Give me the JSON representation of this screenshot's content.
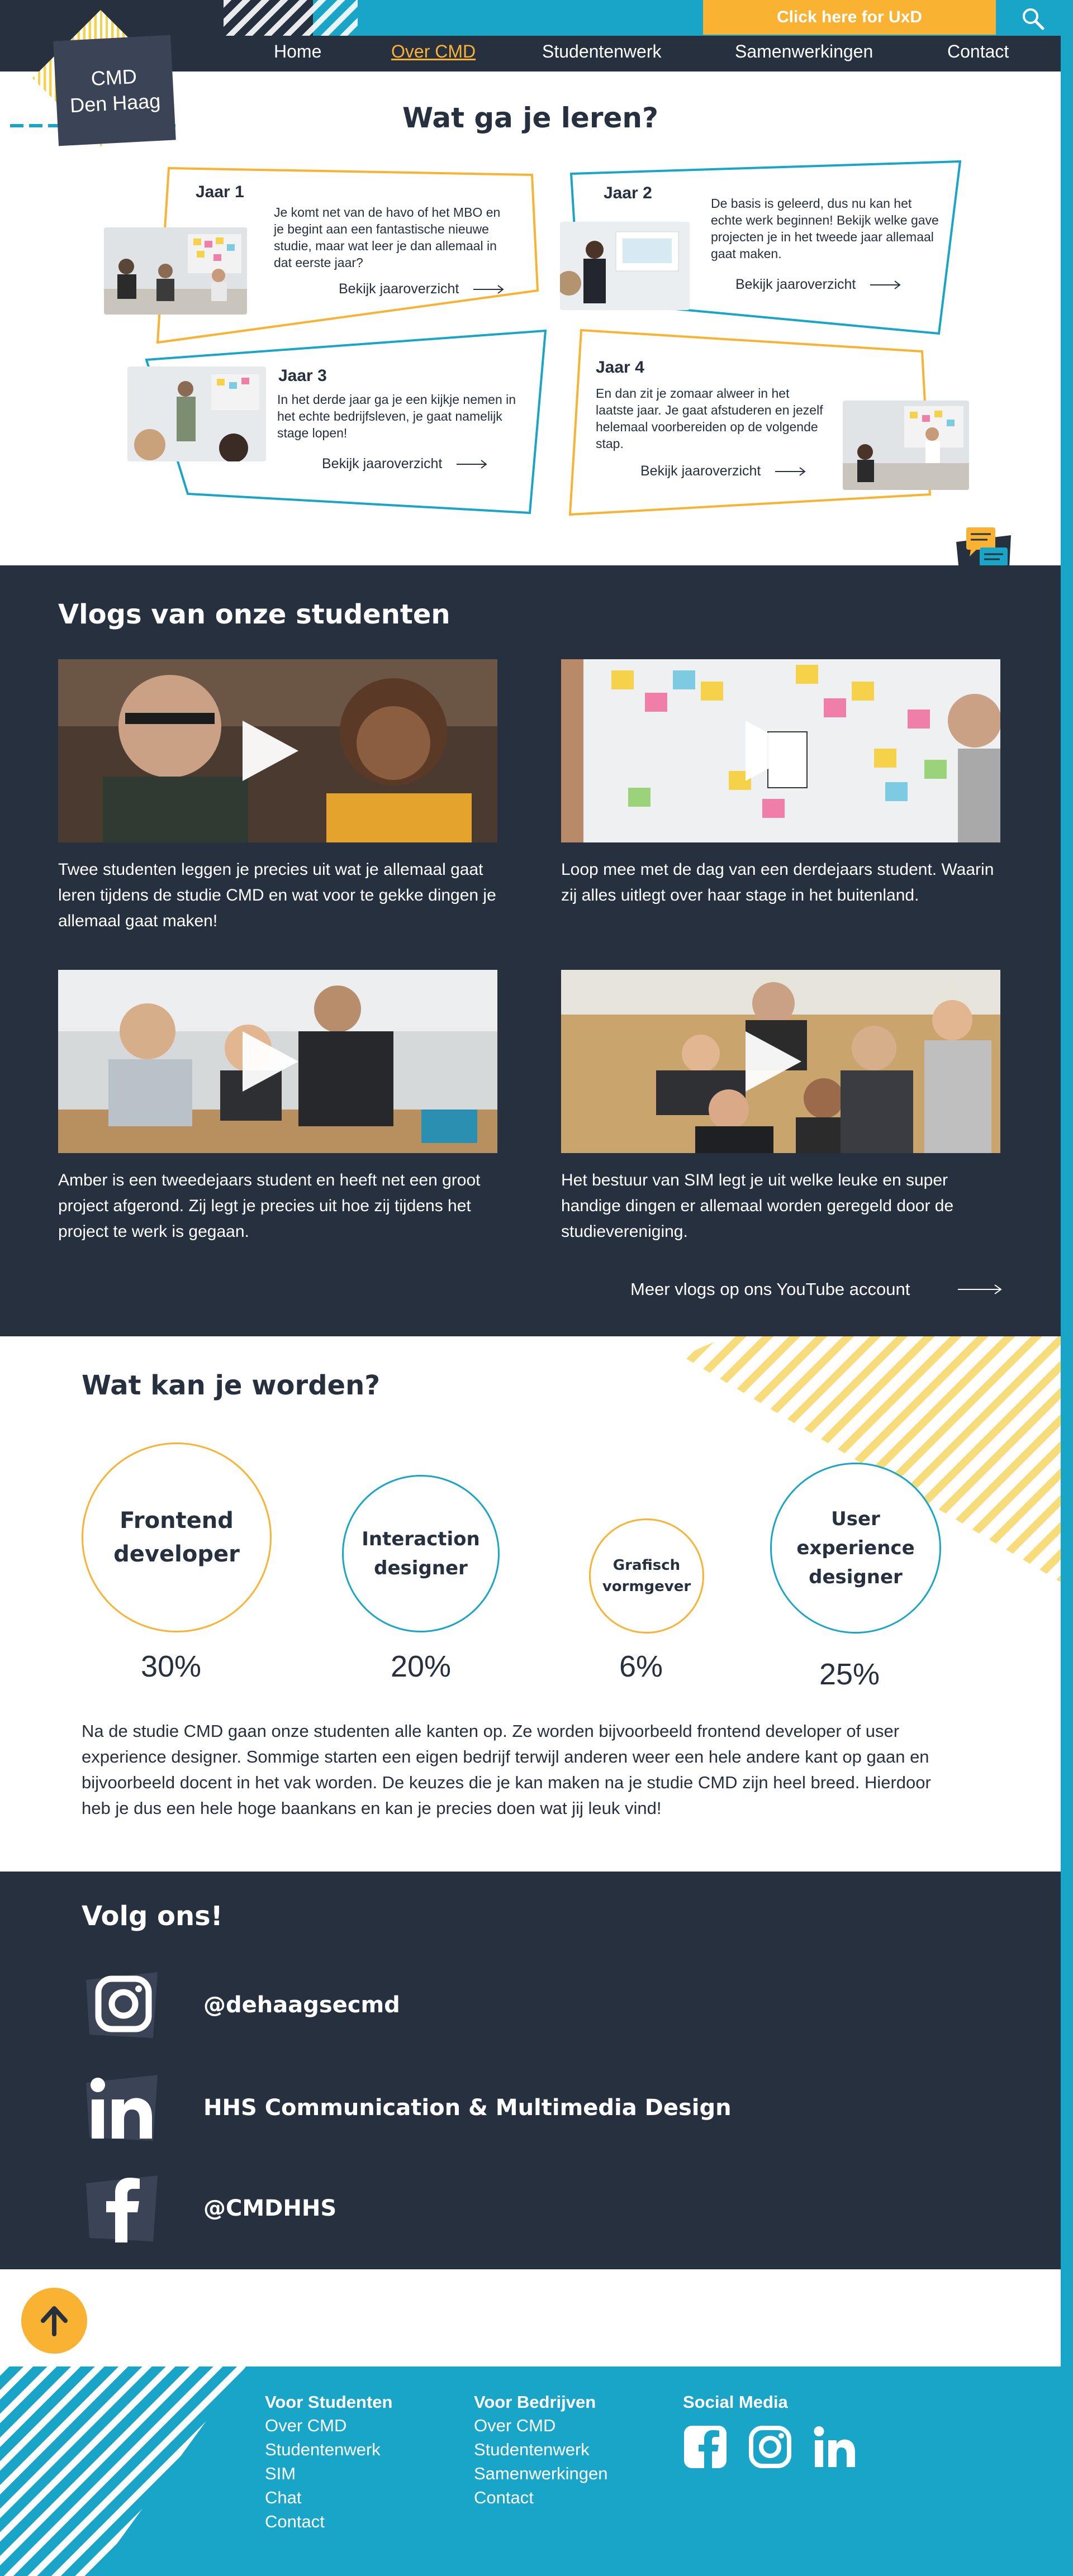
{
  "header": {
    "uxd_button": "Click here for UxD",
    "logo_line1": "CMD",
    "logo_line2": "Den Haag",
    "nav": [
      "Home",
      "Over CMD",
      "Studentenwerk",
      "Samenwerkingen",
      "Contact"
    ],
    "active_nav": "Over CMD"
  },
  "learn": {
    "title": "Wat ga je leren?",
    "years": [
      {
        "label": "Jaar 1",
        "text": "Je komt net van de havo of het MBO en je begint aan een fantastische nieuwe studie, maar wat leer je dan allemaal in dat eerste jaar?",
        "link": "Bekijk jaaroverzicht"
      },
      {
        "label": "Jaar 2",
        "text": "De basis is geleerd, dus nu kan het echte werk beginnen! Bekijk welke gave projecten je in het tweede jaar allemaal gaat maken.",
        "link": "Bekijk jaaroverzicht"
      },
      {
        "label": "Jaar 3",
        "text": "In het derde jaar ga je een kijkje nemen in het echte bedrijfsleven, je gaat namelijk stage lopen!",
        "link": "Bekijk jaaroverzicht"
      },
      {
        "label": "Jaar 4",
        "text": "En dan zit je zomaar alweer in het laatste jaar. Je gaat afstuderen en jezelf helemaal voorbereiden op de volgende stap.",
        "link": "Bekijk jaaroverzicht"
      }
    ]
  },
  "vlogs": {
    "title": "Vlogs van onze studenten",
    "items": [
      {
        "text": "Twee studenten leggen je precies uit wat je allemaal gaat leren tijdens de studie CMD en wat voor te gekke dingen je allemaal gaat maken!"
      },
      {
        "text": "Loop mee met de dag van een derdejaars student. Waarin zij alles uitlegt over haar stage in het buitenland."
      },
      {
        "text": "Amber is een tweedejaars student en heeft net een groot project afgerond. Zij legt je precies uit hoe zij tijdens het project te werk is gegaan."
      },
      {
        "text": "Het bestuur van SIM legt je uit welke leuke en super handige dingen er allemaal worden geregeld door de studievereniging."
      }
    ],
    "more_link": "Meer vlogs op ons YouTube account"
  },
  "careers": {
    "title": "Wat kan je worden?",
    "items": [
      {
        "name": "Frontend developer",
        "percent": "30%",
        "color": "#f9b232"
      },
      {
        "name": "Interaction designer",
        "percent": "20%",
        "color": "#18a5c8"
      },
      {
        "name": "Grafisch vormgever",
        "percent": "6%",
        "color": "#f9b232"
      },
      {
        "name": "User experience designer",
        "percent": "25%",
        "color": "#18a5c8"
      }
    ],
    "text": "Na de studie CMD gaan onze studenten alle kanten op. Ze worden bijvoorbeeld frontend developer of user experience designer. Sommige starten een eigen bedrijf terwijl anderen weer een hele andere kant op gaan en bijvoorbeeld docent in het vak worden. De keuzes die je kan maken na je studie CMD zijn heel breed. Hierdoor heb je dus een hele hoge baankans en kan je precies doen wat jij  leuk vind!"
  },
  "follow": {
    "title": "Volg ons!",
    "accounts": [
      {
        "icon": "instagram-icon",
        "label": "@dehaagsecmd"
      },
      {
        "icon": "linkedin-icon",
        "label": "HHS Communication & Multimedia Design"
      },
      {
        "icon": "facebook-icon",
        "label": "@CMDHHS"
      }
    ]
  },
  "footer": {
    "columns": [
      {
        "heading": "Voor Studenten",
        "links": [
          "Over CMD",
          "Studentenwerk",
          "SIM",
          "Chat",
          "Contact"
        ]
      },
      {
        "heading": "Voor Bedrijven",
        "links": [
          "Over CMD",
          "Studentenwerk",
          "Samenwerkingen",
          "Contact"
        ]
      },
      {
        "heading": "Social Media",
        "links": []
      }
    ]
  },
  "colors": {
    "dark": "#26303f",
    "yellow": "#f9b232",
    "blue": "#18a5c8"
  }
}
